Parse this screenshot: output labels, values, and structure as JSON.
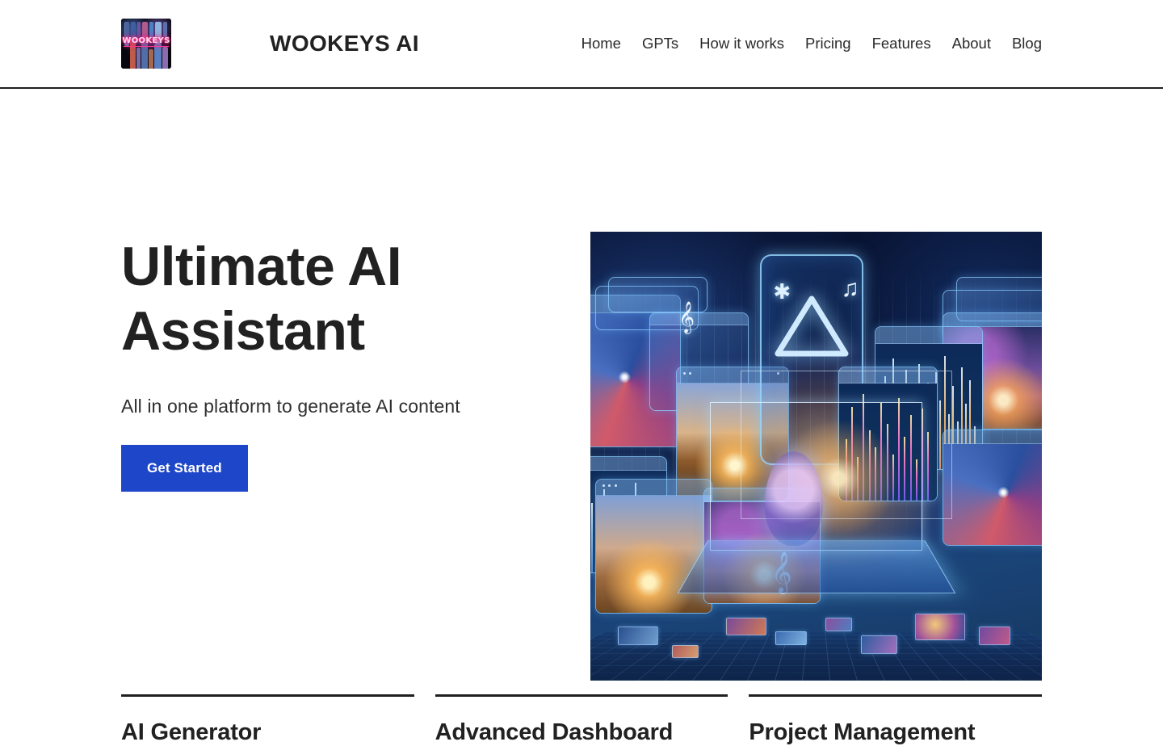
{
  "header": {
    "logo_icon": "wookeys-logo-tile",
    "logo_text": "WOOKEYS",
    "brand_name": "WOOKEYS AI",
    "nav": [
      {
        "label": "Home"
      },
      {
        "label": "GPTs"
      },
      {
        "label": "How it works"
      },
      {
        "label": "Pricing"
      },
      {
        "label": "Features"
      },
      {
        "label": "About"
      },
      {
        "label": "Blog"
      }
    ]
  },
  "hero": {
    "title_line1": "Ultimate AI",
    "title_line2": "Assistant",
    "subtitle": "All in one platform to generate AI content",
    "cta_label": "Get Started",
    "image_alt": "AI generated collage of holographic screens, audio spectrums, galaxy art and a glowing human head over a digital platform"
  },
  "features": [
    {
      "title": "AI Generator"
    },
    {
      "title": "Advanced Dashboard"
    },
    {
      "title": "Project Management"
    }
  ],
  "colors": {
    "accent_blue": "#1E46C8",
    "text_dark": "#212121",
    "rule_dark": "#1f1f1f",
    "page_background": "#ffffff"
  }
}
